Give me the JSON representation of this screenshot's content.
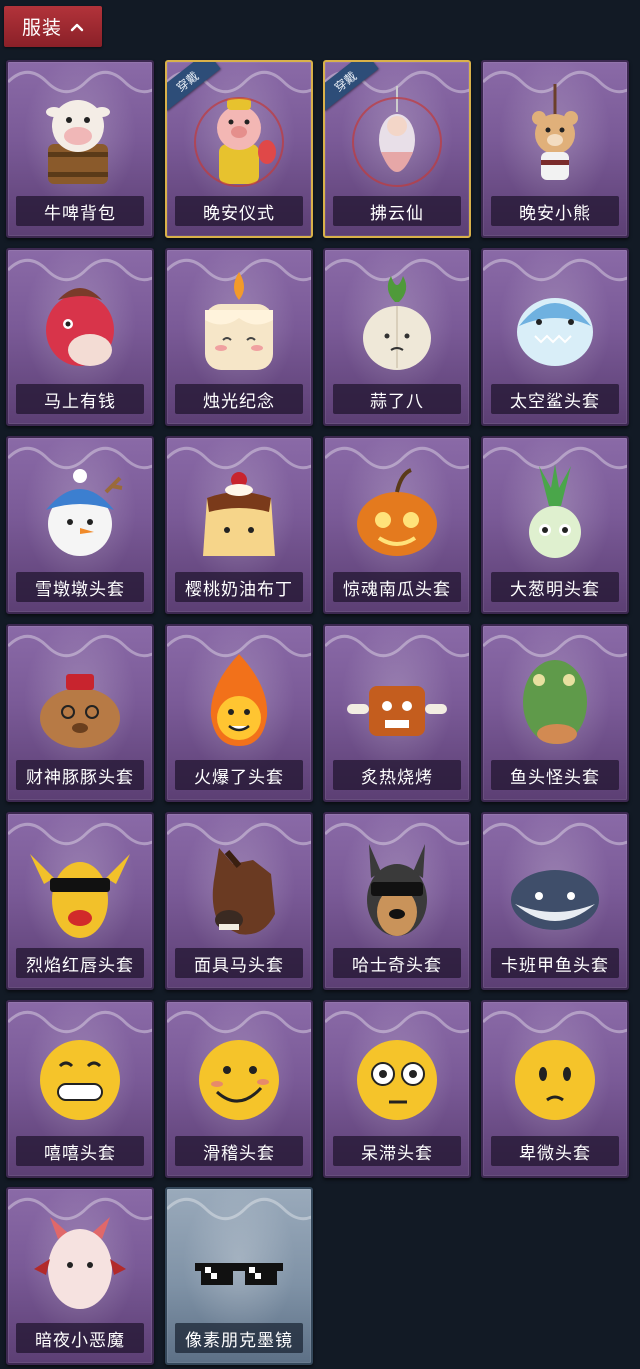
{
  "header": {
    "title": "服装"
  },
  "equipped_badge": "穿戴",
  "items": [
    {
      "name": "牛啤背包",
      "equipped": false,
      "icon": "cow-beer-backpack-icon"
    },
    {
      "name": "晚安仪式",
      "equipped": true,
      "icon": "pig-doll-icon"
    },
    {
      "name": "拂云仙",
      "equipped": true,
      "icon": "cloud-fairy-charm-icon"
    },
    {
      "name": "晚安小熊",
      "equipped": false,
      "icon": "bear-charm-icon"
    },
    {
      "name": "马上有钱",
      "equipped": false,
      "icon": "red-horse-mask-icon"
    },
    {
      "name": "烛光纪念",
      "equipped": false,
      "icon": "candle-mask-icon"
    },
    {
      "name": "蒜了八",
      "equipped": false,
      "icon": "garlic-mask-icon"
    },
    {
      "name": "太空鲨头套",
      "equipped": false,
      "icon": "shark-helmet-icon"
    },
    {
      "name": "雪墩墩头套",
      "equipped": false,
      "icon": "snowman-mask-icon"
    },
    {
      "name": "樱桃奶油布丁",
      "equipped": false,
      "icon": "pudding-mask-icon"
    },
    {
      "name": "惊魂南瓜头套",
      "equipped": false,
      "icon": "pumpkin-mask-icon"
    },
    {
      "name": "大葱明头套",
      "equipped": false,
      "icon": "scallion-mask-icon"
    },
    {
      "name": "财神豚豚头套",
      "equipped": false,
      "icon": "capybara-mask-icon"
    },
    {
      "name": "火爆了头套",
      "equipped": false,
      "icon": "fire-mask-icon"
    },
    {
      "name": "炙热烧烤",
      "equipped": false,
      "icon": "bbq-meat-mask-icon"
    },
    {
      "name": "鱼头怪头套",
      "equipped": false,
      "icon": "fish-head-mask-icon"
    },
    {
      "name": "烈焰红唇头套",
      "equipped": false,
      "icon": "yellow-lips-mask-icon"
    },
    {
      "name": "面具马头套",
      "equipped": false,
      "icon": "horse-head-mask-icon"
    },
    {
      "name": "哈士奇头套",
      "equipped": false,
      "icon": "husky-mask-icon"
    },
    {
      "name": "卡班甲鱼头套",
      "equipped": false,
      "icon": "puffer-fish-mask-icon"
    },
    {
      "name": "嘻嘻头套",
      "equipped": false,
      "icon": "grin-emoji-mask-icon"
    },
    {
      "name": "滑稽头套",
      "equipped": false,
      "icon": "smirk-emoji-mask-icon"
    },
    {
      "name": "呆滞头套",
      "equipped": false,
      "icon": "dazed-emoji-mask-icon"
    },
    {
      "name": "卑微头套",
      "equipped": false,
      "icon": "shy-emoji-mask-icon"
    },
    {
      "name": "暗夜小恶魔",
      "equipped": false,
      "icon": "devil-mask-icon"
    },
    {
      "name": "像素朋克墨镜",
      "equipped": false,
      "icon": "pixel-sunglasses-icon"
    }
  ],
  "colors": {
    "background": "#121a25",
    "header": "#b2333a",
    "card_purple": "#7a5a97",
    "card_glass": "#7f92a6",
    "equipped_border": "#d9b14a",
    "badge": "#2d4d78"
  }
}
